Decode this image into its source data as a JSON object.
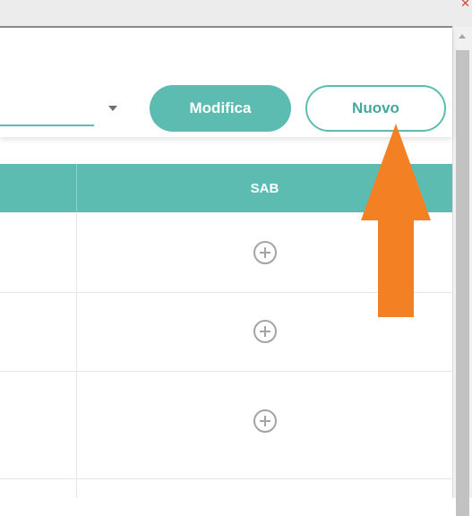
{
  "toolbar": {
    "modifica_label": "Modifica",
    "nuovo_label": "Nuovo"
  },
  "table": {
    "columns": [
      "",
      "SAB"
    ],
    "rows": [
      {
        "action_icon": "plus-circle-icon"
      },
      {
        "action_icon": "plus-circle-icon"
      },
      {
        "action_icon": "plus-circle-icon"
      }
    ]
  },
  "colors": {
    "accent": "#5cbcb1",
    "arrow": "#f48024"
  },
  "icons": [
    "close-icon",
    "dropdown-caret-icon",
    "plus-circle-icon",
    "arrow-up-icon"
  ]
}
